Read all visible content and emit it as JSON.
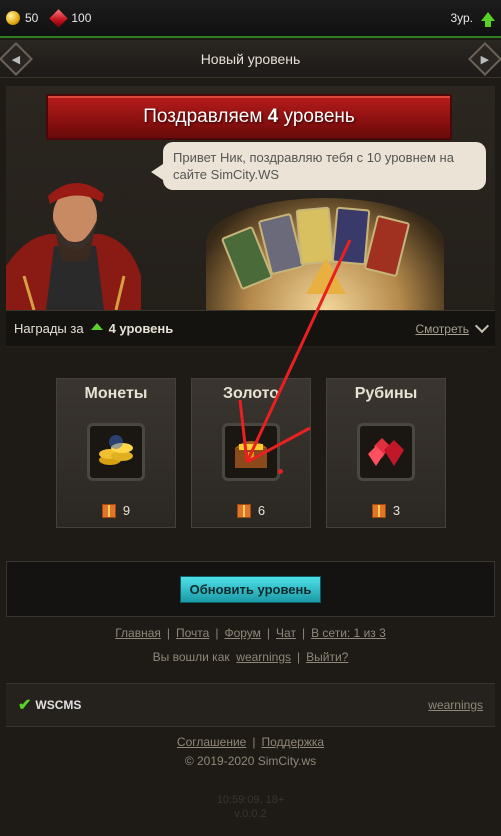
{
  "topbar": {
    "coins": "50",
    "rubies": "100",
    "level_label": "3ур."
  },
  "titlebar": {
    "title": "Новый уровень"
  },
  "congrats": {
    "prefix": "Поздравляем",
    "level": "4",
    "suffix": "уровень"
  },
  "bubble": {
    "text": "Привет Ник, поздравляю тебя с 10 уровнем на сайте SimCity.WS"
  },
  "rewards_bar": {
    "label": "Награды за",
    "level": "4 уровень",
    "see_more": "Смотреть"
  },
  "rewards": [
    {
      "title": "Монеты",
      "icon": "coins-icon",
      "count": "9"
    },
    {
      "title": "Золото",
      "icon": "chest-icon",
      "count": "6"
    },
    {
      "title": "Рубины",
      "icon": "rubies-icon",
      "count": "3"
    }
  ],
  "update_button": "Обновить уровень",
  "nav_links": [
    "Главная",
    "Почта",
    "Форум",
    "Чат",
    "В сети: 1 из 3"
  ],
  "login": {
    "prefix": "Вы вошли как",
    "user": "wearnings",
    "logout": "Выйти?"
  },
  "footer": {
    "brand": "WSCMS",
    "user": "wearnings"
  },
  "bottom_links": [
    "Соглашение",
    "Поддержка"
  ],
  "copyright": "© 2019-2020 SimCity.ws",
  "time": "10:59:09, 18+",
  "version": "v.0.0.2",
  "colors": {
    "accent": "#2e7d1f",
    "ribbon": "#b71c1c",
    "button": "#33c0cc"
  }
}
